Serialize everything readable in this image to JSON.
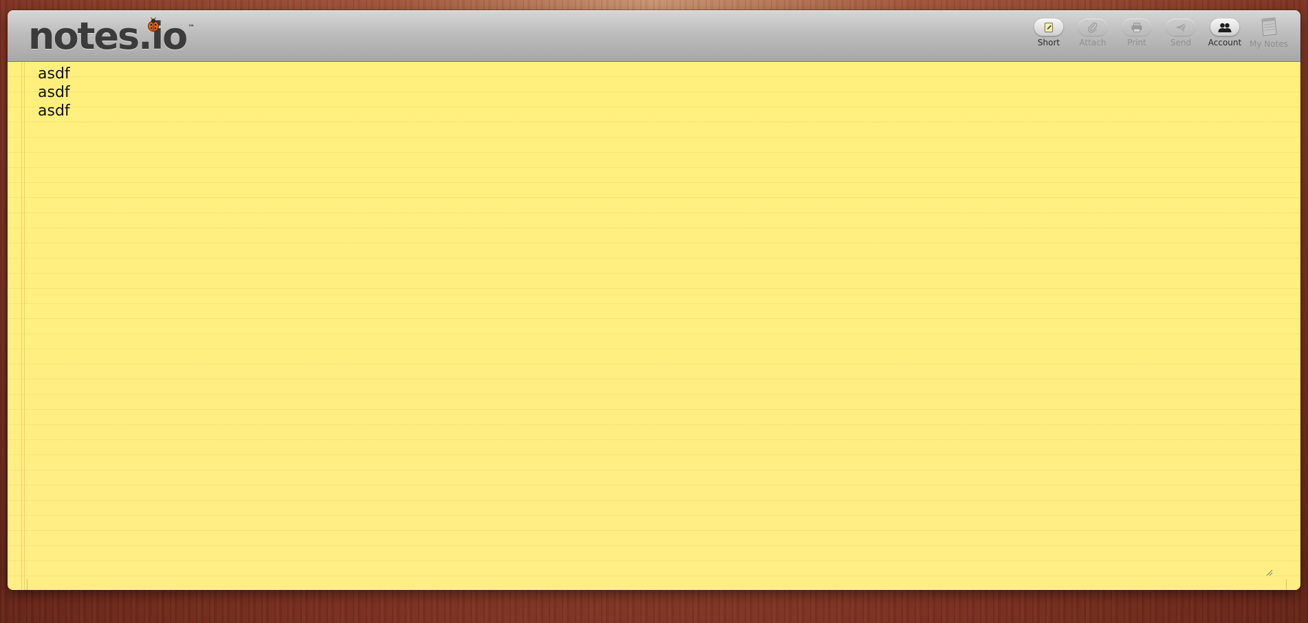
{
  "app": {
    "logo_text": "notes.io",
    "tm": "™"
  },
  "toolbar": {
    "buttons": [
      {
        "label": "Short",
        "icon": "short-note-icon",
        "enabled": true
      },
      {
        "label": "Attach",
        "icon": "paperclip-icon",
        "enabled": false
      },
      {
        "label": "Print",
        "icon": "printer-icon",
        "enabled": false
      },
      {
        "label": "Send",
        "icon": "paper-plane-icon",
        "enabled": false
      },
      {
        "label": "Account",
        "icon": "users-icon",
        "enabled": true
      },
      {
        "label": "My Notes",
        "icon": "notepad-icon",
        "enabled": false
      }
    ]
  },
  "note": {
    "content": "asdf\nasdf\nasdf"
  },
  "colors": {
    "paper": "#fff082",
    "toolbar": "#bdbdbd",
    "logo": "#3b3b3b"
  }
}
